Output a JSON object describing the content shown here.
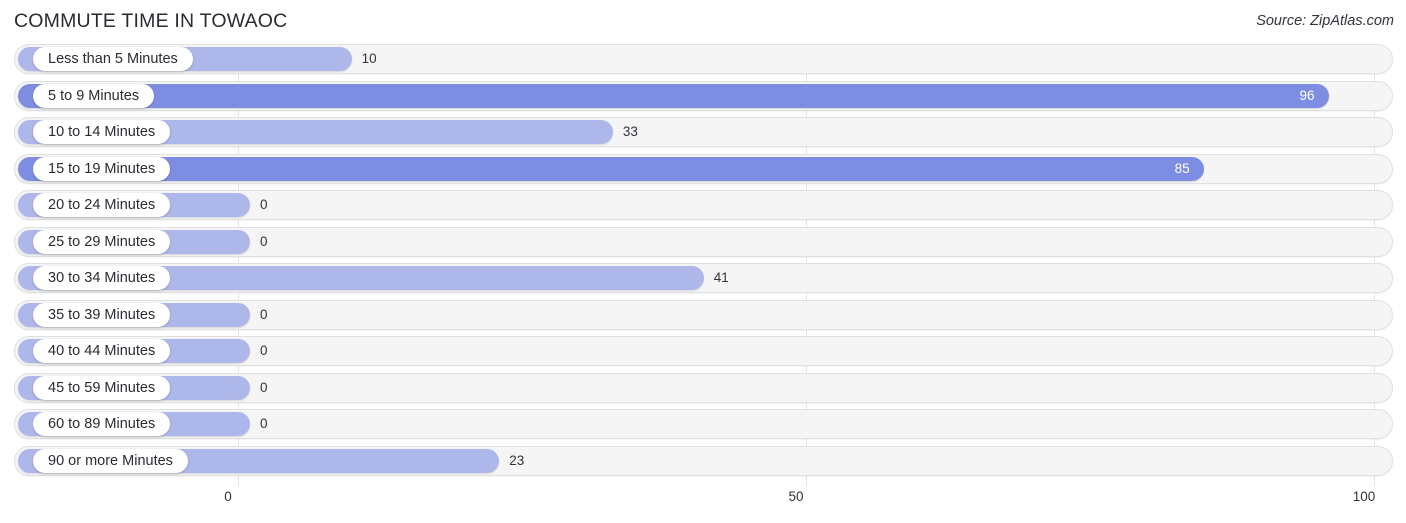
{
  "header": {
    "title": "COMMUTE TIME IN TOWAOC",
    "source": "Source: ZipAtlas.com"
  },
  "axis": {
    "ticks": [
      "0",
      "50",
      "100"
    ]
  },
  "chart_data": {
    "type": "bar",
    "orientation": "horizontal",
    "title": "COMMUTE TIME IN TOWAOC",
    "subtitle": "Source: ZipAtlas.com",
    "xlabel": "",
    "ylabel": "",
    "xlim": [
      0,
      100
    ],
    "grid": true,
    "legend": false,
    "xticks": [
      0,
      50,
      100
    ],
    "accent_color_light": "#aeb7ea",
    "accent_color_dark": "#7d8ee2",
    "categories": [
      "Less than 5 Minutes",
      "5 to 9 Minutes",
      "10 to 14 Minutes",
      "15 to 19 Minutes",
      "20 to 24 Minutes",
      "25 to 29 Minutes",
      "30 to 34 Minutes",
      "35 to 39 Minutes",
      "40 to 44 Minutes",
      "45 to 59 Minutes",
      "60 to 89 Minutes",
      "90 or more Minutes"
    ],
    "values": [
      10,
      96,
      33,
      85,
      0,
      0,
      41,
      0,
      0,
      0,
      0,
      23
    ],
    "bars": [
      {
        "label": "Less than 5 Minutes",
        "value": 10,
        "value_text": "10",
        "shade": "light",
        "label_inside": false
      },
      {
        "label": "5 to 9 Minutes",
        "value": 96,
        "value_text": "96",
        "shade": "dark",
        "label_inside": true
      },
      {
        "label": "10 to 14 Minutes",
        "value": 33,
        "value_text": "33",
        "shade": "light",
        "label_inside": false
      },
      {
        "label": "15 to 19 Minutes",
        "value": 85,
        "value_text": "85",
        "shade": "dark",
        "label_inside": true
      },
      {
        "label": "20 to 24 Minutes",
        "value": 0,
        "value_text": "0",
        "shade": "light",
        "label_inside": false
      },
      {
        "label": "25 to 29 Minutes",
        "value": 0,
        "value_text": "0",
        "shade": "light",
        "label_inside": false
      },
      {
        "label": "30 to 34 Minutes",
        "value": 41,
        "value_text": "41",
        "shade": "light",
        "label_inside": false
      },
      {
        "label": "35 to 39 Minutes",
        "value": 0,
        "value_text": "0",
        "shade": "light",
        "label_inside": false
      },
      {
        "label": "40 to 44 Minutes",
        "value": 0,
        "value_text": "0",
        "shade": "light",
        "label_inside": false
      },
      {
        "label": "45 to 59 Minutes",
        "value": 0,
        "value_text": "0",
        "shade": "light",
        "label_inside": false
      },
      {
        "label": "60 to 89 Minutes",
        "value": 0,
        "value_text": "0",
        "shade": "light",
        "label_inside": false
      },
      {
        "label": "90 or more Minutes",
        "value": 23,
        "value_text": "23",
        "shade": "light",
        "label_inside": false
      }
    ]
  }
}
